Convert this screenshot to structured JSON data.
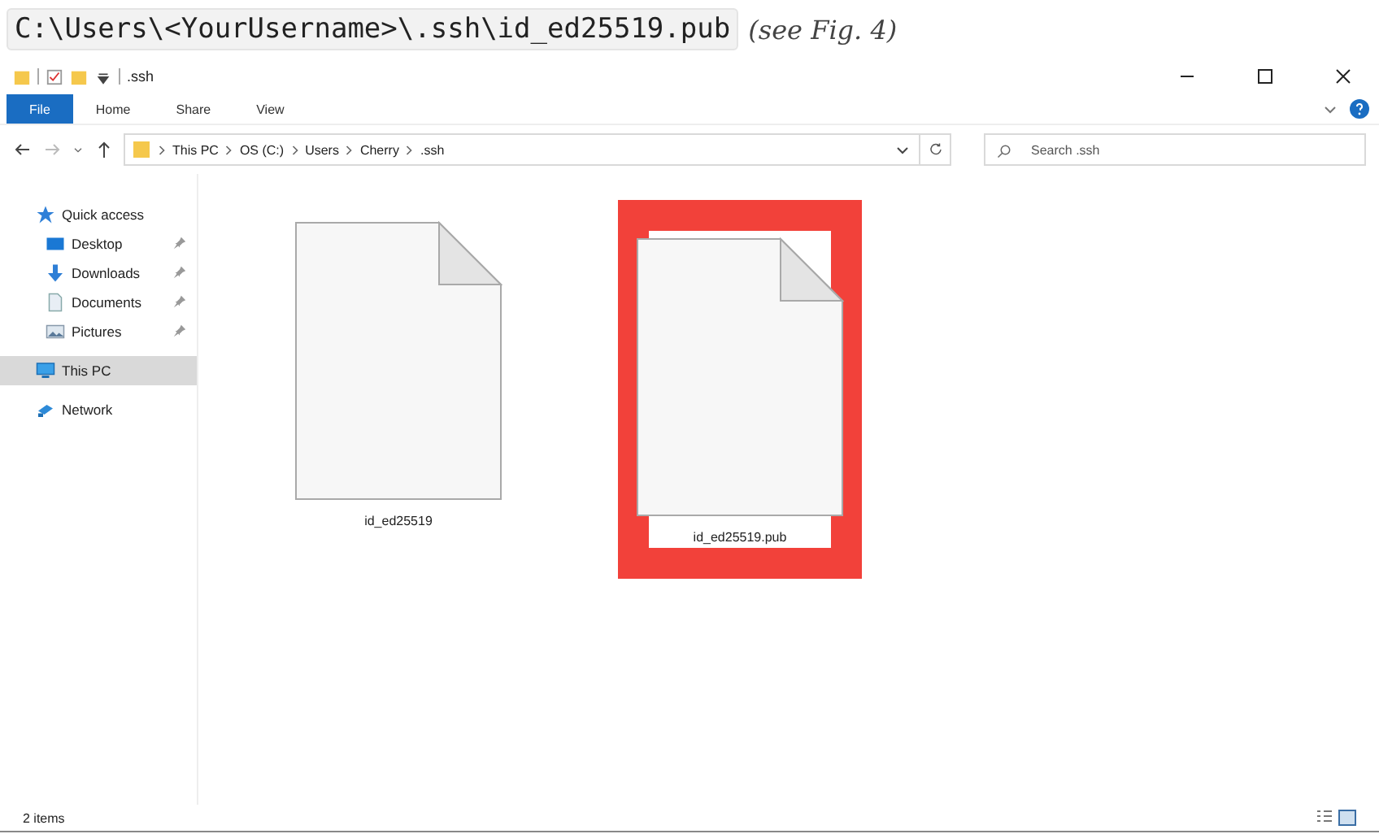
{
  "caption": {
    "path": "C:\\Users\\<YourUsername>\\.ssh\\id_ed25519.pub",
    "note": "(see Fig. 4)"
  },
  "window": {
    "title": ".ssh"
  },
  "ribbon_tabs": [
    {
      "label": "File",
      "selected": true
    },
    {
      "label": "Home",
      "selected": false
    },
    {
      "label": "Share",
      "selected": false
    },
    {
      "label": "View",
      "selected": false
    }
  ],
  "breadcrumb": [
    "This PC",
    "OS (C:)",
    "Users",
    "Cherry",
    ".ssh"
  ],
  "search": {
    "placeholder": "Search .ssh"
  },
  "sidebar": [
    {
      "label": "Quick access",
      "kind": "star",
      "selected": false,
      "children": [
        {
          "label": "Desktop",
          "kind": "desktop",
          "pinned": true,
          "selected": false
        },
        {
          "label": "Downloads",
          "kind": "download",
          "pinned": true,
          "selected": false
        },
        {
          "label": "Documents",
          "kind": "document",
          "pinned": true,
          "selected": false
        },
        {
          "label": "Pictures",
          "kind": "pictures",
          "pinned": true,
          "selected": false
        }
      ]
    },
    {
      "label": "This PC",
      "kind": "pc",
      "selected": true
    },
    {
      "label": "Network",
      "kind": "network",
      "selected": false
    }
  ],
  "files": [
    {
      "name": "id_ed25519",
      "highlighted": false
    },
    {
      "name": "id_ed25519.pub",
      "highlighted": true
    }
  ],
  "status_bar": {
    "count": "2 items"
  }
}
